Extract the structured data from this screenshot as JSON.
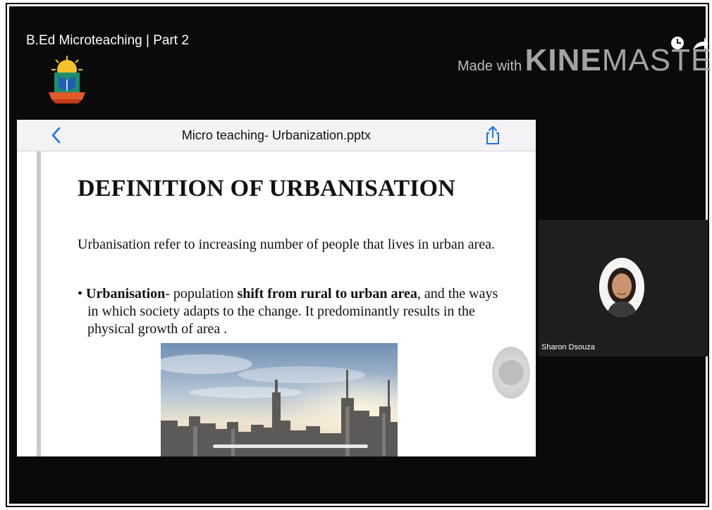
{
  "video": {
    "title": "B.Ed Microteaching | Part 2",
    "watermark": {
      "prefix": "Made with",
      "brand_bold": "KINE",
      "brand_light": "MASTER"
    }
  },
  "viewer": {
    "document_title": "Micro teaching- Urbanization.pptx",
    "icons": {
      "back": "chevron-left-icon",
      "share": "share-icon"
    },
    "accent_color": "#1a73e8"
  },
  "slide": {
    "heading": "DEFINITION OF URBANISATION",
    "paragraph": "Urbanisation refer to increasing number of people that lives in urban area.",
    "bullet": {
      "marker": "•",
      "term": "Urbanisation",
      "text_1": "- population ",
      "emphasis": "shift from rural to urban area",
      "text_2": ", and the ways in which society adapts to the change. It predominantly results in the physical growth of area ."
    }
  },
  "participant": {
    "name": "Sharon Dsouza"
  }
}
